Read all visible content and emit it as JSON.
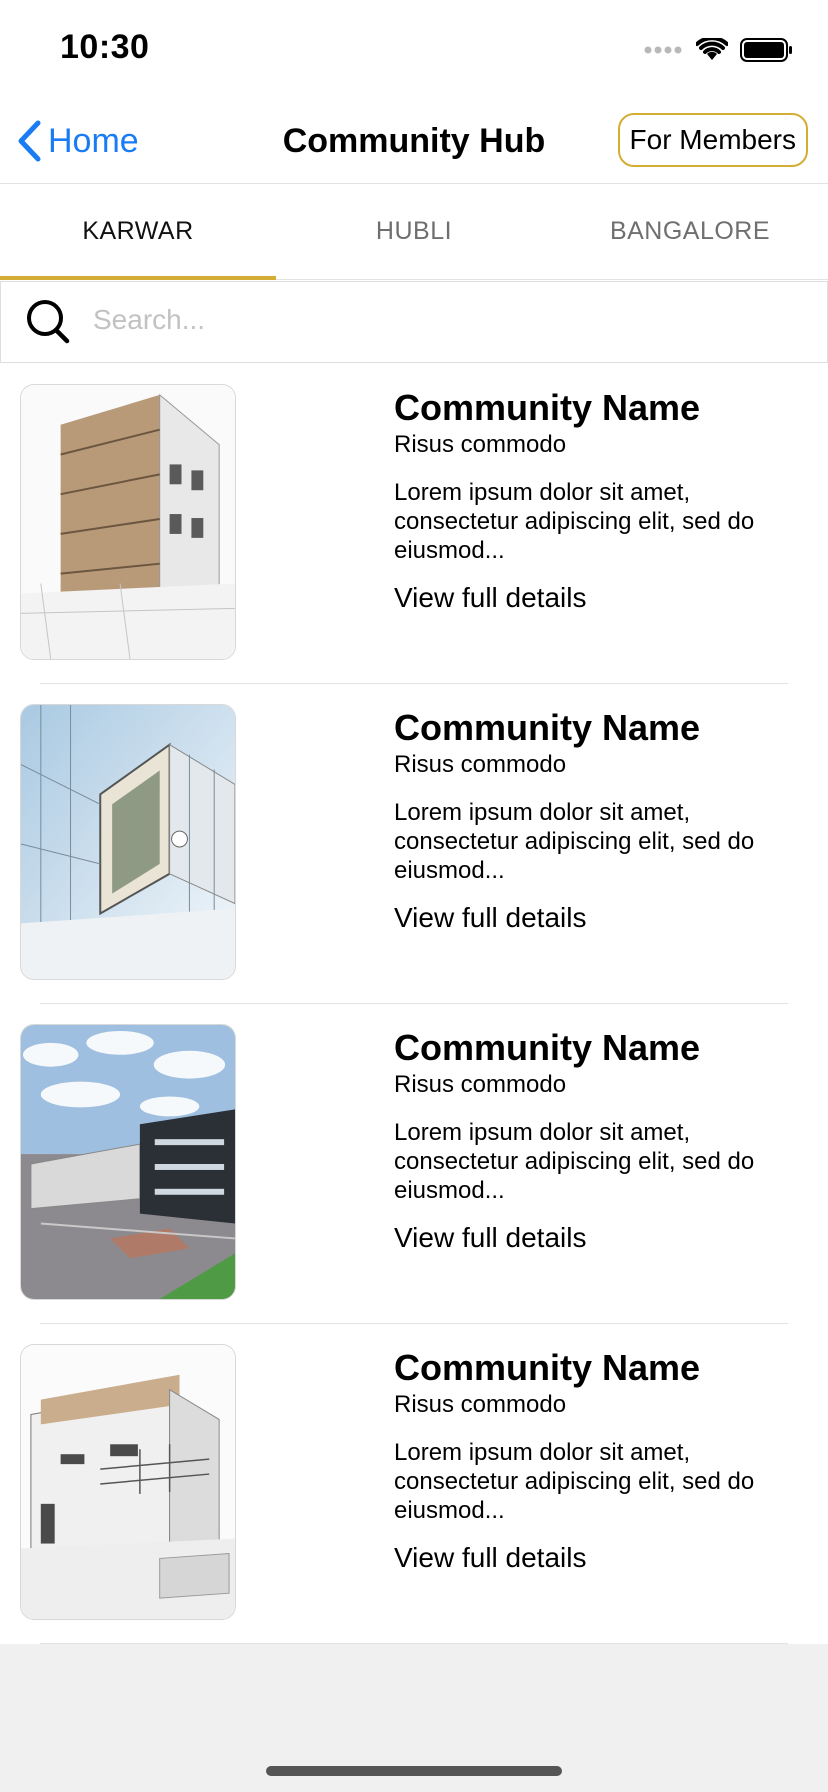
{
  "status_bar": {
    "time": "10:30"
  },
  "nav": {
    "back_label": "Home",
    "title": "Community Hub",
    "members_label": "For Members",
    "accent_color": "#d4ad35",
    "link_color": "#1a7cf5"
  },
  "tabs": [
    {
      "label": "KARWAR",
      "active": true
    },
    {
      "label": "HUBLI",
      "active": false
    },
    {
      "label": "BANGALORE",
      "active": false
    }
  ],
  "search": {
    "placeholder": "Search...",
    "value": ""
  },
  "communities": [
    {
      "title": "Community Name",
      "subtitle": "Risus commodo",
      "description": "Lorem ipsum dolor sit amet, consectetur adipiscing elit, sed do eiusmod...",
      "link": "View full details",
      "image": "wood-facade-building-sketch"
    },
    {
      "title": "Community Name",
      "subtitle": "Risus commodo",
      "description": "Lorem ipsum dolor sit amet, consectetur adipiscing elit, sed do eiusmod...",
      "link": "View full details",
      "image": "glass-office-building-sketch"
    },
    {
      "title": "Community Name",
      "subtitle": "Risus commodo",
      "description": "Lorem ipsum dolor sit amet, consectetur adipiscing elit, sed do eiusmod...",
      "link": "View full details",
      "image": "modern-building-sky-render"
    },
    {
      "title": "Community Name",
      "subtitle": "Risus commodo",
      "description": "Lorem ipsum dolor sit amet, consectetur adipiscing elit, sed do eiusmod...",
      "link": "View full details",
      "image": "white-house-sketch"
    }
  ]
}
